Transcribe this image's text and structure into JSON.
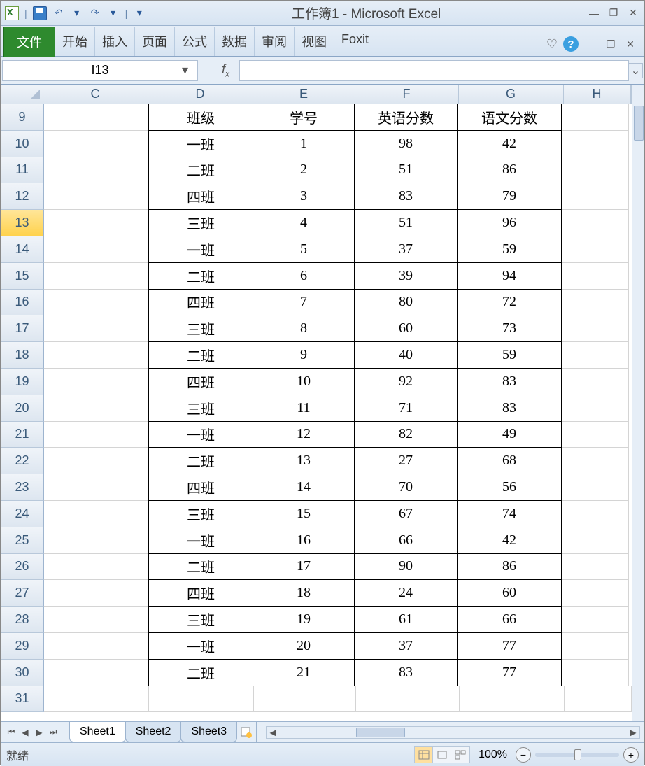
{
  "app": {
    "title": "工作簿1 - Microsoft Excel"
  },
  "qat": {
    "undo_glyph": "↶",
    "redo_glyph": "↷",
    "dropdown_glyph": "▾",
    "sep": "|"
  },
  "ribbon": {
    "file": "文件",
    "tabs": [
      "开始",
      "插入",
      "页面",
      "公式",
      "数据",
      "审阅",
      "视图",
      "Foxit"
    ],
    "heart": "♡"
  },
  "formula": {
    "cell_ref": "I13",
    "fx": "f",
    "fx_sub": "x"
  },
  "columns": [
    "C",
    "D",
    "E",
    "F",
    "G",
    "H"
  ],
  "selected_row": 13,
  "headers": {
    "D": "班级",
    "E": "学号",
    "F": "英语分数",
    "G": "语文分数"
  },
  "rows": [
    {
      "n": 9,
      "D": "班级",
      "E": "学号",
      "F": "英语分数",
      "G": "语文分数",
      "hdr": true
    },
    {
      "n": 10,
      "D": "一班",
      "E": "1",
      "F": "98",
      "G": "42"
    },
    {
      "n": 11,
      "D": "二班",
      "E": "2",
      "F": "51",
      "G": "86"
    },
    {
      "n": 12,
      "D": "四班",
      "E": "3",
      "F": "83",
      "G": "79"
    },
    {
      "n": 13,
      "D": "三班",
      "E": "4",
      "F": "51",
      "G": "96"
    },
    {
      "n": 14,
      "D": "一班",
      "E": "5",
      "F": "37",
      "G": "59"
    },
    {
      "n": 15,
      "D": "二班",
      "E": "6",
      "F": "39",
      "G": "94"
    },
    {
      "n": 16,
      "D": "四班",
      "E": "7",
      "F": "80",
      "G": "72"
    },
    {
      "n": 17,
      "D": "三班",
      "E": "8",
      "F": "60",
      "G": "73"
    },
    {
      "n": 18,
      "D": "二班",
      "E": "9",
      "F": "40",
      "G": "59"
    },
    {
      "n": 19,
      "D": "四班",
      "E": "10",
      "F": "92",
      "G": "83"
    },
    {
      "n": 20,
      "D": "三班",
      "E": "11",
      "F": "71",
      "G": "83"
    },
    {
      "n": 21,
      "D": "一班",
      "E": "12",
      "F": "82",
      "G": "49"
    },
    {
      "n": 22,
      "D": "二班",
      "E": "13",
      "F": "27",
      "G": "68"
    },
    {
      "n": 23,
      "D": "四班",
      "E": "14",
      "F": "70",
      "G": "56"
    },
    {
      "n": 24,
      "D": "三班",
      "E": "15",
      "F": "67",
      "G": "74"
    },
    {
      "n": 25,
      "D": "一班",
      "E": "16",
      "F": "66",
      "G": "42"
    },
    {
      "n": 26,
      "D": "二班",
      "E": "17",
      "F": "90",
      "G": "86"
    },
    {
      "n": 27,
      "D": "四班",
      "E": "18",
      "F": "24",
      "G": "60"
    },
    {
      "n": 28,
      "D": "三班",
      "E": "19",
      "F": "61",
      "G": "66"
    },
    {
      "n": 29,
      "D": "一班",
      "E": "20",
      "F": "37",
      "G": "77"
    },
    {
      "n": 30,
      "D": "二班",
      "E": "21",
      "F": "83",
      "G": "77"
    },
    {
      "n": 31,
      "D": "",
      "E": "",
      "F": "",
      "G": ""
    }
  ],
  "sheets": {
    "tabs": [
      "Sheet1",
      "Sheet2",
      "Sheet3"
    ],
    "active": 0
  },
  "status": {
    "ready": "就绪",
    "zoom": "100%"
  },
  "glyphs": {
    "nav_first": "⏮",
    "nav_prev": "◀",
    "nav_next": "▶",
    "nav_last": "⏭",
    "tri_left": "◀",
    "tri_right": "▶",
    "minus": "−",
    "plus": "+",
    "chev": "⌄",
    "min": "—",
    "max": "□",
    "close": "✕",
    "restore": "❐"
  }
}
